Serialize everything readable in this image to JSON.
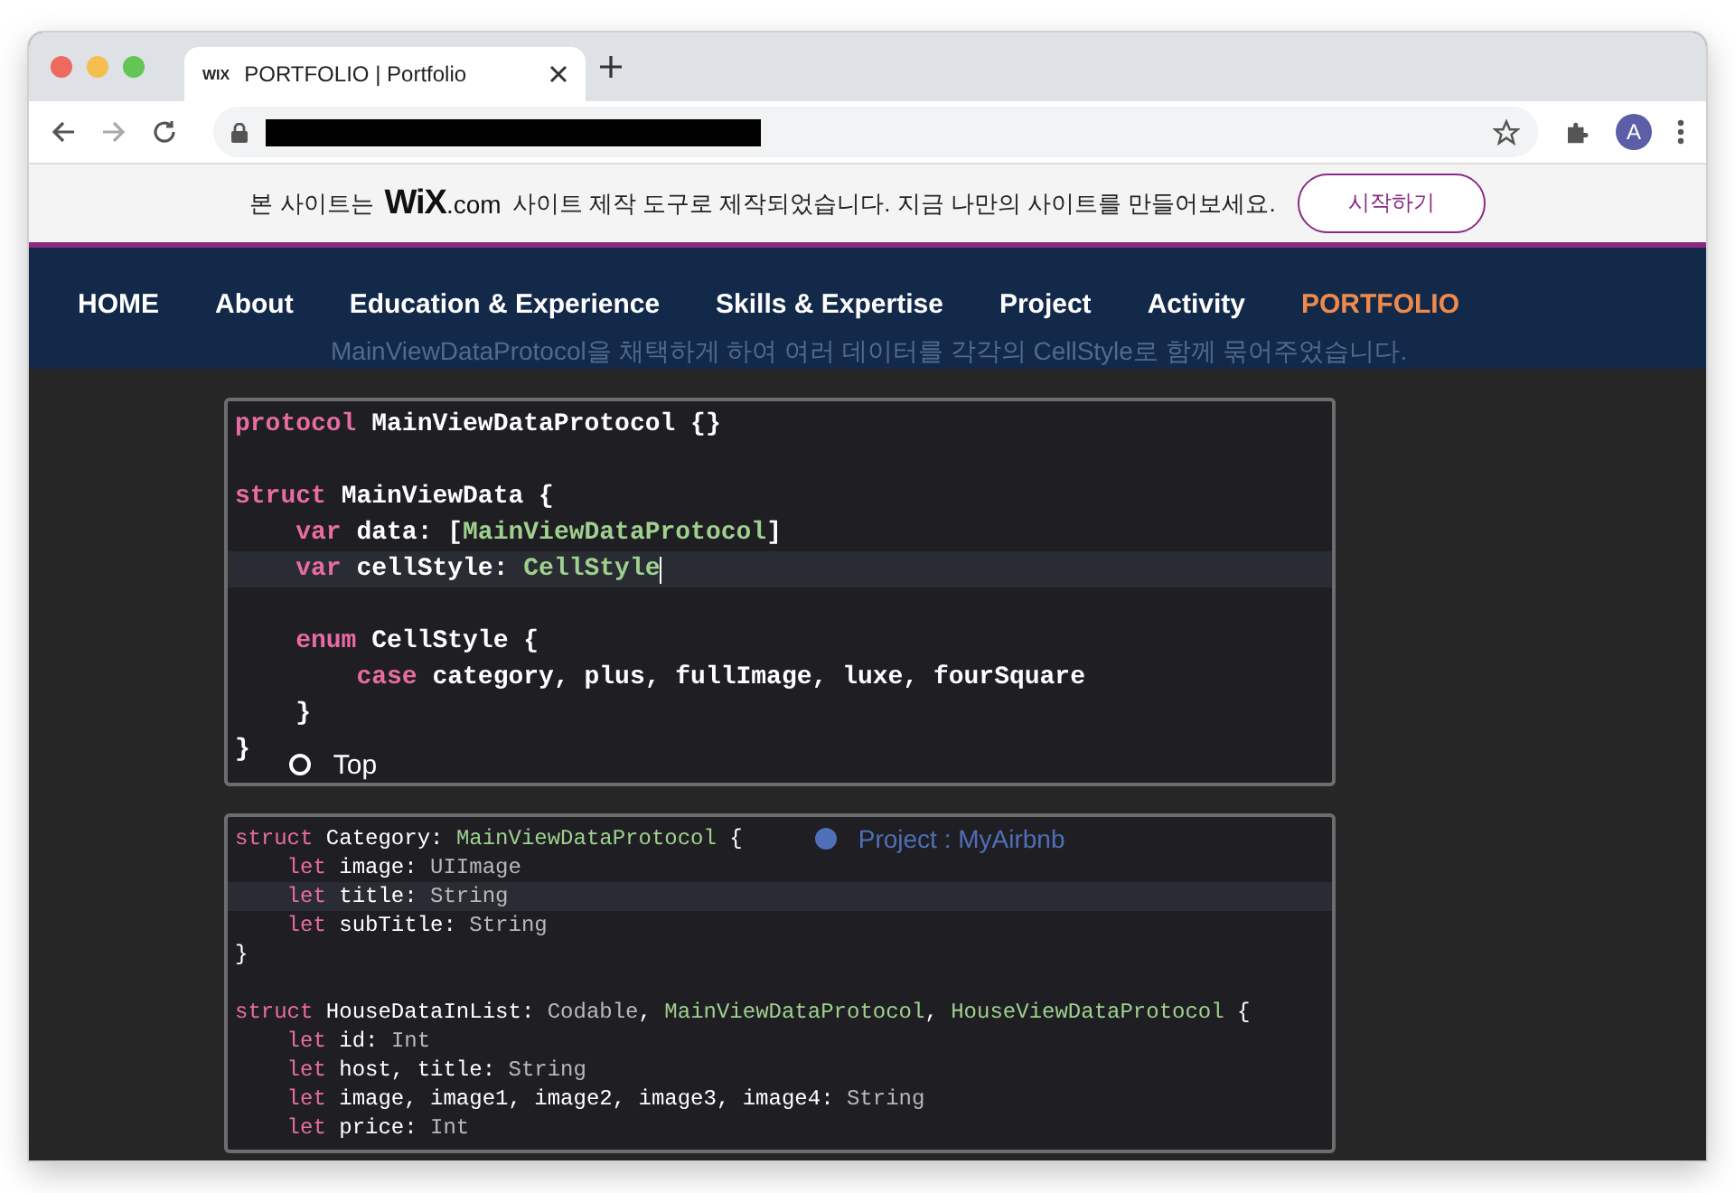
{
  "browser": {
    "tab": {
      "favicon": "WIX",
      "title": "PORTFOLIO | Portfolio"
    },
    "avatar": "A"
  },
  "banner": {
    "text_before": "본 사이트는",
    "logo": "WiX",
    "logo_suffix": ".com",
    "text_after": "사이트 제작 도구로 제작되었습니다. 지금 나만의 사이트를 만들어보세요.",
    "button": "시작하기"
  },
  "nav": {
    "items": [
      {
        "label": "HOME",
        "selected": false
      },
      {
        "label": "About",
        "selected": false
      },
      {
        "label": "Education & Experience",
        "selected": false
      },
      {
        "label": "Skills & Expertise",
        "selected": false
      },
      {
        "label": "Project",
        "selected": false
      },
      {
        "label": "Activity",
        "selected": false
      },
      {
        "label": "PORTFOLIO",
        "selected": true
      }
    ]
  },
  "background_text": "MainViewDataProtocol을 채택하게 하여 여러 데이터를 각각의 CellStyle로 함께 묶어주었습니다.",
  "code_blocks": [
    {
      "kind": "large",
      "lines": [
        {
          "kind": "code",
          "highlighted": false,
          "tokens": [
            {
              "kind": "keyword",
              "text": "protocol"
            },
            {
              "kind": "plain",
              "text": " MainViewDataProtocol {}"
            }
          ]
        },
        {
          "kind": "blank"
        },
        {
          "kind": "code",
          "highlighted": false,
          "tokens": [
            {
              "kind": "keyword",
              "text": "struct"
            },
            {
              "kind": "plain",
              "text": " MainViewData {"
            }
          ]
        },
        {
          "kind": "code",
          "highlighted": false,
          "tokens": [
            {
              "kind": "keyword",
              "text": "    var"
            },
            {
              "kind": "plain",
              "text": " data: ["
            },
            {
              "kind": "type",
              "text": "MainViewDataProtocol"
            },
            {
              "kind": "plain",
              "text": "]"
            }
          ]
        },
        {
          "kind": "code",
          "highlighted": true,
          "cursor": true,
          "tokens": [
            {
              "kind": "keyword",
              "text": "    var"
            },
            {
              "kind": "plain",
              "text": " cellStyle: "
            },
            {
              "kind": "type",
              "text": "CellStyle"
            }
          ]
        },
        {
          "kind": "blank"
        },
        {
          "kind": "code",
          "highlighted": false,
          "tokens": [
            {
              "kind": "keyword",
              "text": "    enum"
            },
            {
              "kind": "plain",
              "text": " CellStyle {"
            }
          ]
        },
        {
          "kind": "code",
          "highlighted": false,
          "tokens": [
            {
              "kind": "keyword",
              "text": "        case"
            },
            {
              "kind": "plain",
              "text": " category, plus, fullImage, luxe, fourSquare"
            }
          ]
        },
        {
          "kind": "code",
          "highlighted": false,
          "tokens": [
            {
              "kind": "plain",
              "text": "    }"
            }
          ]
        },
        {
          "kind": "code",
          "highlighted": false,
          "tokens": [
            {
              "kind": "plain",
              "text": "}"
            }
          ]
        }
      ]
    },
    {
      "kind": "small",
      "lines": [
        {
          "kind": "code",
          "highlighted": false,
          "tokens": [
            {
              "kind": "keyword",
              "text": "struct"
            },
            {
              "kind": "plain",
              "text": " Category: "
            },
            {
              "kind": "type",
              "text": "MainViewDataProtocol"
            },
            {
              "kind": "plain",
              "text": " {"
            }
          ]
        },
        {
          "kind": "code",
          "highlighted": false,
          "tokens": [
            {
              "kind": "keyword",
              "text": "    let"
            },
            {
              "kind": "plain",
              "text": " image: "
            },
            {
              "kind": "builtin",
              "text": "UIImage"
            }
          ]
        },
        {
          "kind": "code",
          "highlighted": true,
          "cursor": false,
          "tokens": [
            {
              "kind": "keyword",
              "text": "    let"
            },
            {
              "kind": "plain",
              "text": " title: "
            },
            {
              "kind": "builtin",
              "text": "String"
            }
          ]
        },
        {
          "kind": "code",
          "highlighted": false,
          "tokens": [
            {
              "kind": "keyword",
              "text": "    let"
            },
            {
              "kind": "plain",
              "text": " subTitle: "
            },
            {
              "kind": "builtin",
              "text": "String"
            }
          ]
        },
        {
          "kind": "code",
          "highlighted": false,
          "tokens": [
            {
              "kind": "plain",
              "text": "}"
            }
          ]
        },
        {
          "kind": "blank"
        },
        {
          "kind": "code",
          "highlighted": false,
          "tokens": [
            {
              "kind": "keyword",
              "text": "struct"
            },
            {
              "kind": "plain",
              "text": " HouseDataInList: "
            },
            {
              "kind": "builtin",
              "text": "Codable"
            },
            {
              "kind": "plain",
              "text": ", "
            },
            {
              "kind": "type",
              "text": "MainViewDataProtocol"
            },
            {
              "kind": "plain",
              "text": ", "
            },
            {
              "kind": "type",
              "text": "HouseViewDataProtocol"
            },
            {
              "kind": "plain",
              "text": " {"
            }
          ]
        },
        {
          "kind": "code",
          "highlighted": false,
          "tokens": [
            {
              "kind": "keyword",
              "text": "    let"
            },
            {
              "kind": "plain",
              "text": " id: "
            },
            {
              "kind": "builtin",
              "text": "Int"
            }
          ]
        },
        {
          "kind": "code",
          "highlighted": false,
          "tokens": [
            {
              "kind": "keyword",
              "text": "    let"
            },
            {
              "kind": "plain",
              "text": " host, title: "
            },
            {
              "kind": "builtin",
              "text": "String"
            }
          ]
        },
        {
          "kind": "code",
          "highlighted": false,
          "tokens": [
            {
              "kind": "keyword",
              "text": "    let"
            },
            {
              "kind": "plain",
              "text": " image, image1, image2, image3, image4: "
            },
            {
              "kind": "builtin",
              "text": "String"
            }
          ]
        },
        {
          "kind": "code",
          "highlighted": false,
          "tokens": [
            {
              "kind": "keyword",
              "text": "    let"
            },
            {
              "kind": "plain",
              "text": " price: "
            },
            {
              "kind": "builtin",
              "text": "Int"
            }
          ]
        }
      ]
    }
  ],
  "floating_nav": [
    {
      "label": "Top",
      "selected": false
    },
    {
      "label": "Project : MyAirbnb",
      "selected": true
    }
  ]
}
